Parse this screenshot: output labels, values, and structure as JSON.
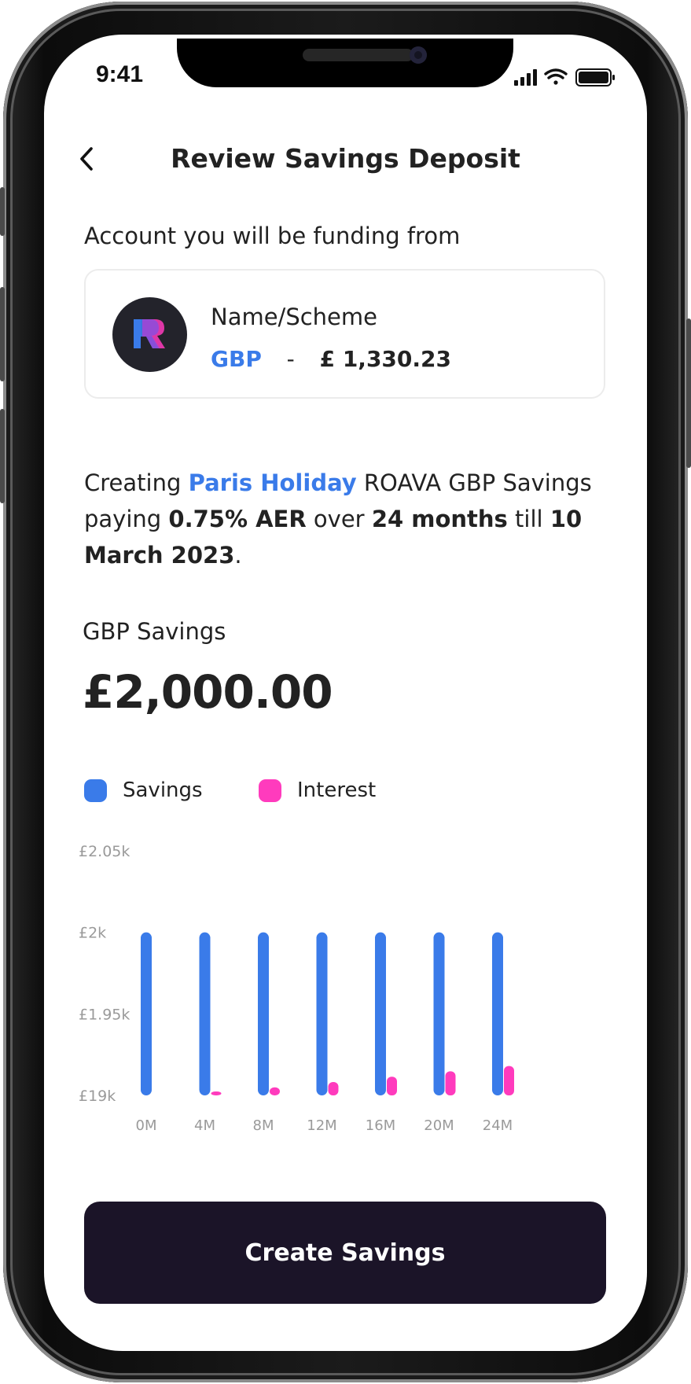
{
  "status_bar": {
    "time": "9:41"
  },
  "header": {
    "title": "Review Savings Deposit",
    "back_icon": "chevron-left-icon"
  },
  "funding": {
    "label": "Account you will be funding from",
    "account_name": "Name/Scheme",
    "currency": "GBP",
    "separator": "-",
    "balance": "£ 1,330.23",
    "logo_icon": "roava-logo"
  },
  "description": {
    "p1": "Creating ",
    "savings_name": "Paris Holiday",
    "p2": " ROAVA GBP Savings paying ",
    "rate": "0.75% AER",
    "p3": " over ",
    "term": "24 months",
    "p4": " till ",
    "end_date": "10 March 2023",
    "p5": "."
  },
  "savings": {
    "label": "GBP Savings",
    "amount": "£2,000.00"
  },
  "legend": {
    "savings": "Savings",
    "interest": "Interest"
  },
  "colors": {
    "accent_blue": "#3a7be9",
    "interest_pink": "#ff3bbd",
    "button_dark": "#1b1428"
  },
  "chart_data": {
    "type": "bar",
    "categories": [
      "0M",
      "4M",
      "8M",
      "12M",
      "16M",
      "20M",
      "24M"
    ],
    "y_tick_labels": [
      "£2.05k",
      "£2k",
      "£1.95k",
      "£19k"
    ],
    "y_tick_values": [
      2050,
      2000,
      1950,
      1900
    ],
    "ylim": [
      1900,
      2050
    ],
    "series": [
      {
        "name": "Savings",
        "values": [
          2000,
          2000,
          2000,
          2000,
          2000,
          2000,
          2000
        ]
      },
      {
        "name": "Interest",
        "values": [
          0,
          1,
          3,
          5,
          7,
          9,
          11
        ]
      }
    ],
    "grid": false,
    "legend": "top-left"
  },
  "cta": {
    "label": "Create Savings"
  }
}
